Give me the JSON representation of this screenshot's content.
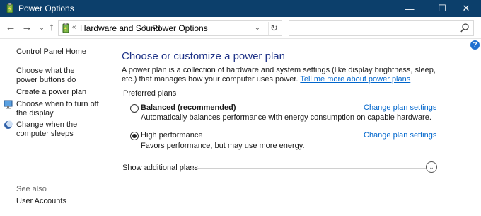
{
  "window": {
    "title": "Power Options",
    "minimize_glyph": "—",
    "maximize_glyph": "☐",
    "close_glyph": "✕"
  },
  "nav": {
    "back_glyph": "←",
    "forward_glyph": "→",
    "recent_glyph": "⌄",
    "up_glyph": "↑",
    "overflow_glyph": "«",
    "breadcrumb": [
      "Hardware and Sound",
      "Power Options"
    ],
    "separator": "›",
    "dropdown_glyph": "⌄",
    "refresh_glyph": "↻",
    "search_placeholder": ""
  },
  "sidebar": {
    "home": "Control Panel Home",
    "items": [
      {
        "label": "Choose what the power buttons do",
        "icon": "none"
      },
      {
        "label": "Create a power plan",
        "icon": "none"
      },
      {
        "label": "Choose when to turn off the display",
        "icon": "monitor-icon"
      },
      {
        "label": "Change when the computer sleeps",
        "icon": "moon-icon"
      }
    ],
    "see_also": "See also",
    "see_also_items": [
      "User Accounts"
    ]
  },
  "main": {
    "heading": "Choose or customize a power plan",
    "description": "A power plan is a collection of hardware and system settings (like display brightness, sleep, etc.) that manages how your computer uses power.",
    "tell_me_more": "Tell me more about power plans",
    "preferred_label": "Preferred plans",
    "plans": [
      {
        "name": "Balanced (recommended)",
        "description": "Automatically balances performance with energy consumption on capable hardware.",
        "selected": false,
        "link": "Change plan settings"
      },
      {
        "name": "High performance",
        "description": "Favors performance, but may use more energy.",
        "selected": true,
        "link": "Change plan settings"
      }
    ],
    "additional_label": "Show additional plans",
    "expand_glyph": "⌄"
  },
  "help_glyph": "?",
  "colors": {
    "titlebar": "#0c3f6b",
    "heading": "#1e3287",
    "link": "#0066cc",
    "help": "#1e6fd0"
  }
}
